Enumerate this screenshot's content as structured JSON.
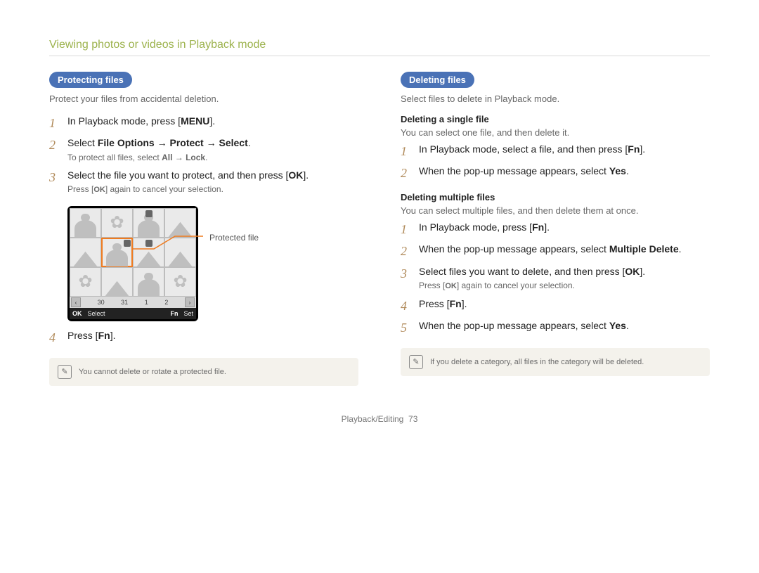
{
  "page_title": "Viewing photos or videos in Playback mode",
  "footer_section": "Playback/Editing",
  "footer_page": "73",
  "left": {
    "heading": "Protecting files",
    "intro": "Protect your files from accidental deletion.",
    "steps": {
      "s1": {
        "num": "1",
        "text_a": "In Playback mode, press [",
        "key": "MENU",
        "text_b": "]."
      },
      "s2": {
        "num": "2",
        "label_select": "Select ",
        "bold": "File Options → Protect → Select",
        "tail": ".",
        "sub_a": "To protect all files, select ",
        "sub_bold": "All → Lock",
        "sub_b": "."
      },
      "s3": {
        "num": "3",
        "text_a": "Select the file you want to protect, and then press [",
        "key": "OK",
        "text_b": "].",
        "sub_a": "Press [",
        "sub_key": "OK",
        "sub_b": "] again to cancel your selection."
      },
      "s4": {
        "num": "4",
        "text_a": "Press [",
        "key": "Fn",
        "text_b": "]."
      }
    },
    "figure": {
      "caption": "Protected file",
      "datebar": {
        "d1": "30",
        "d2": "31",
        "d3": "1",
        "d4": "2"
      },
      "ctrl": {
        "k1": "OK",
        "l1": "Select",
        "k2": "Fn",
        "l2": "Set"
      }
    },
    "note": "You cannot delete or rotate a protected file."
  },
  "right": {
    "heading": "Deleting files",
    "intro": "Select files to delete in Playback mode.",
    "sec1": {
      "title": "Deleting a single file",
      "desc": "You can select one file, and then delete it.",
      "s1": {
        "num": "1",
        "text_a": "In Playback mode, select a file, and then press [",
        "key": "Fn",
        "text_b": "]."
      },
      "s2": {
        "num": "2",
        "text_a": "When the pop-up message appears, select ",
        "bold": "Yes",
        "tail": "."
      }
    },
    "sec2": {
      "title": "Deleting multiple files",
      "desc": "You can select multiple files, and then delete them at once.",
      "s1": {
        "num": "1",
        "text_a": "In Playback mode, press [",
        "key": "Fn",
        "text_b": "]."
      },
      "s2": {
        "num": "2",
        "text_a": "When the pop-up message appears, select ",
        "bold": "Multiple Delete",
        "tail": "."
      },
      "s3": {
        "num": "3",
        "text_a": "Select files you want to delete, and then press [",
        "key": "OK",
        "text_b": "].",
        "sub_a": "Press [",
        "sub_key": "OK",
        "sub_b": "] again to cancel your selection."
      },
      "s4": {
        "num": "4",
        "text_a": "Press [",
        "key": "Fn",
        "text_b": "]."
      },
      "s5": {
        "num": "5",
        "text_a": "When the pop-up message appears, select ",
        "bold": "Yes",
        "tail": "."
      }
    },
    "note": "If you delete a category, all files in the category will be deleted."
  }
}
